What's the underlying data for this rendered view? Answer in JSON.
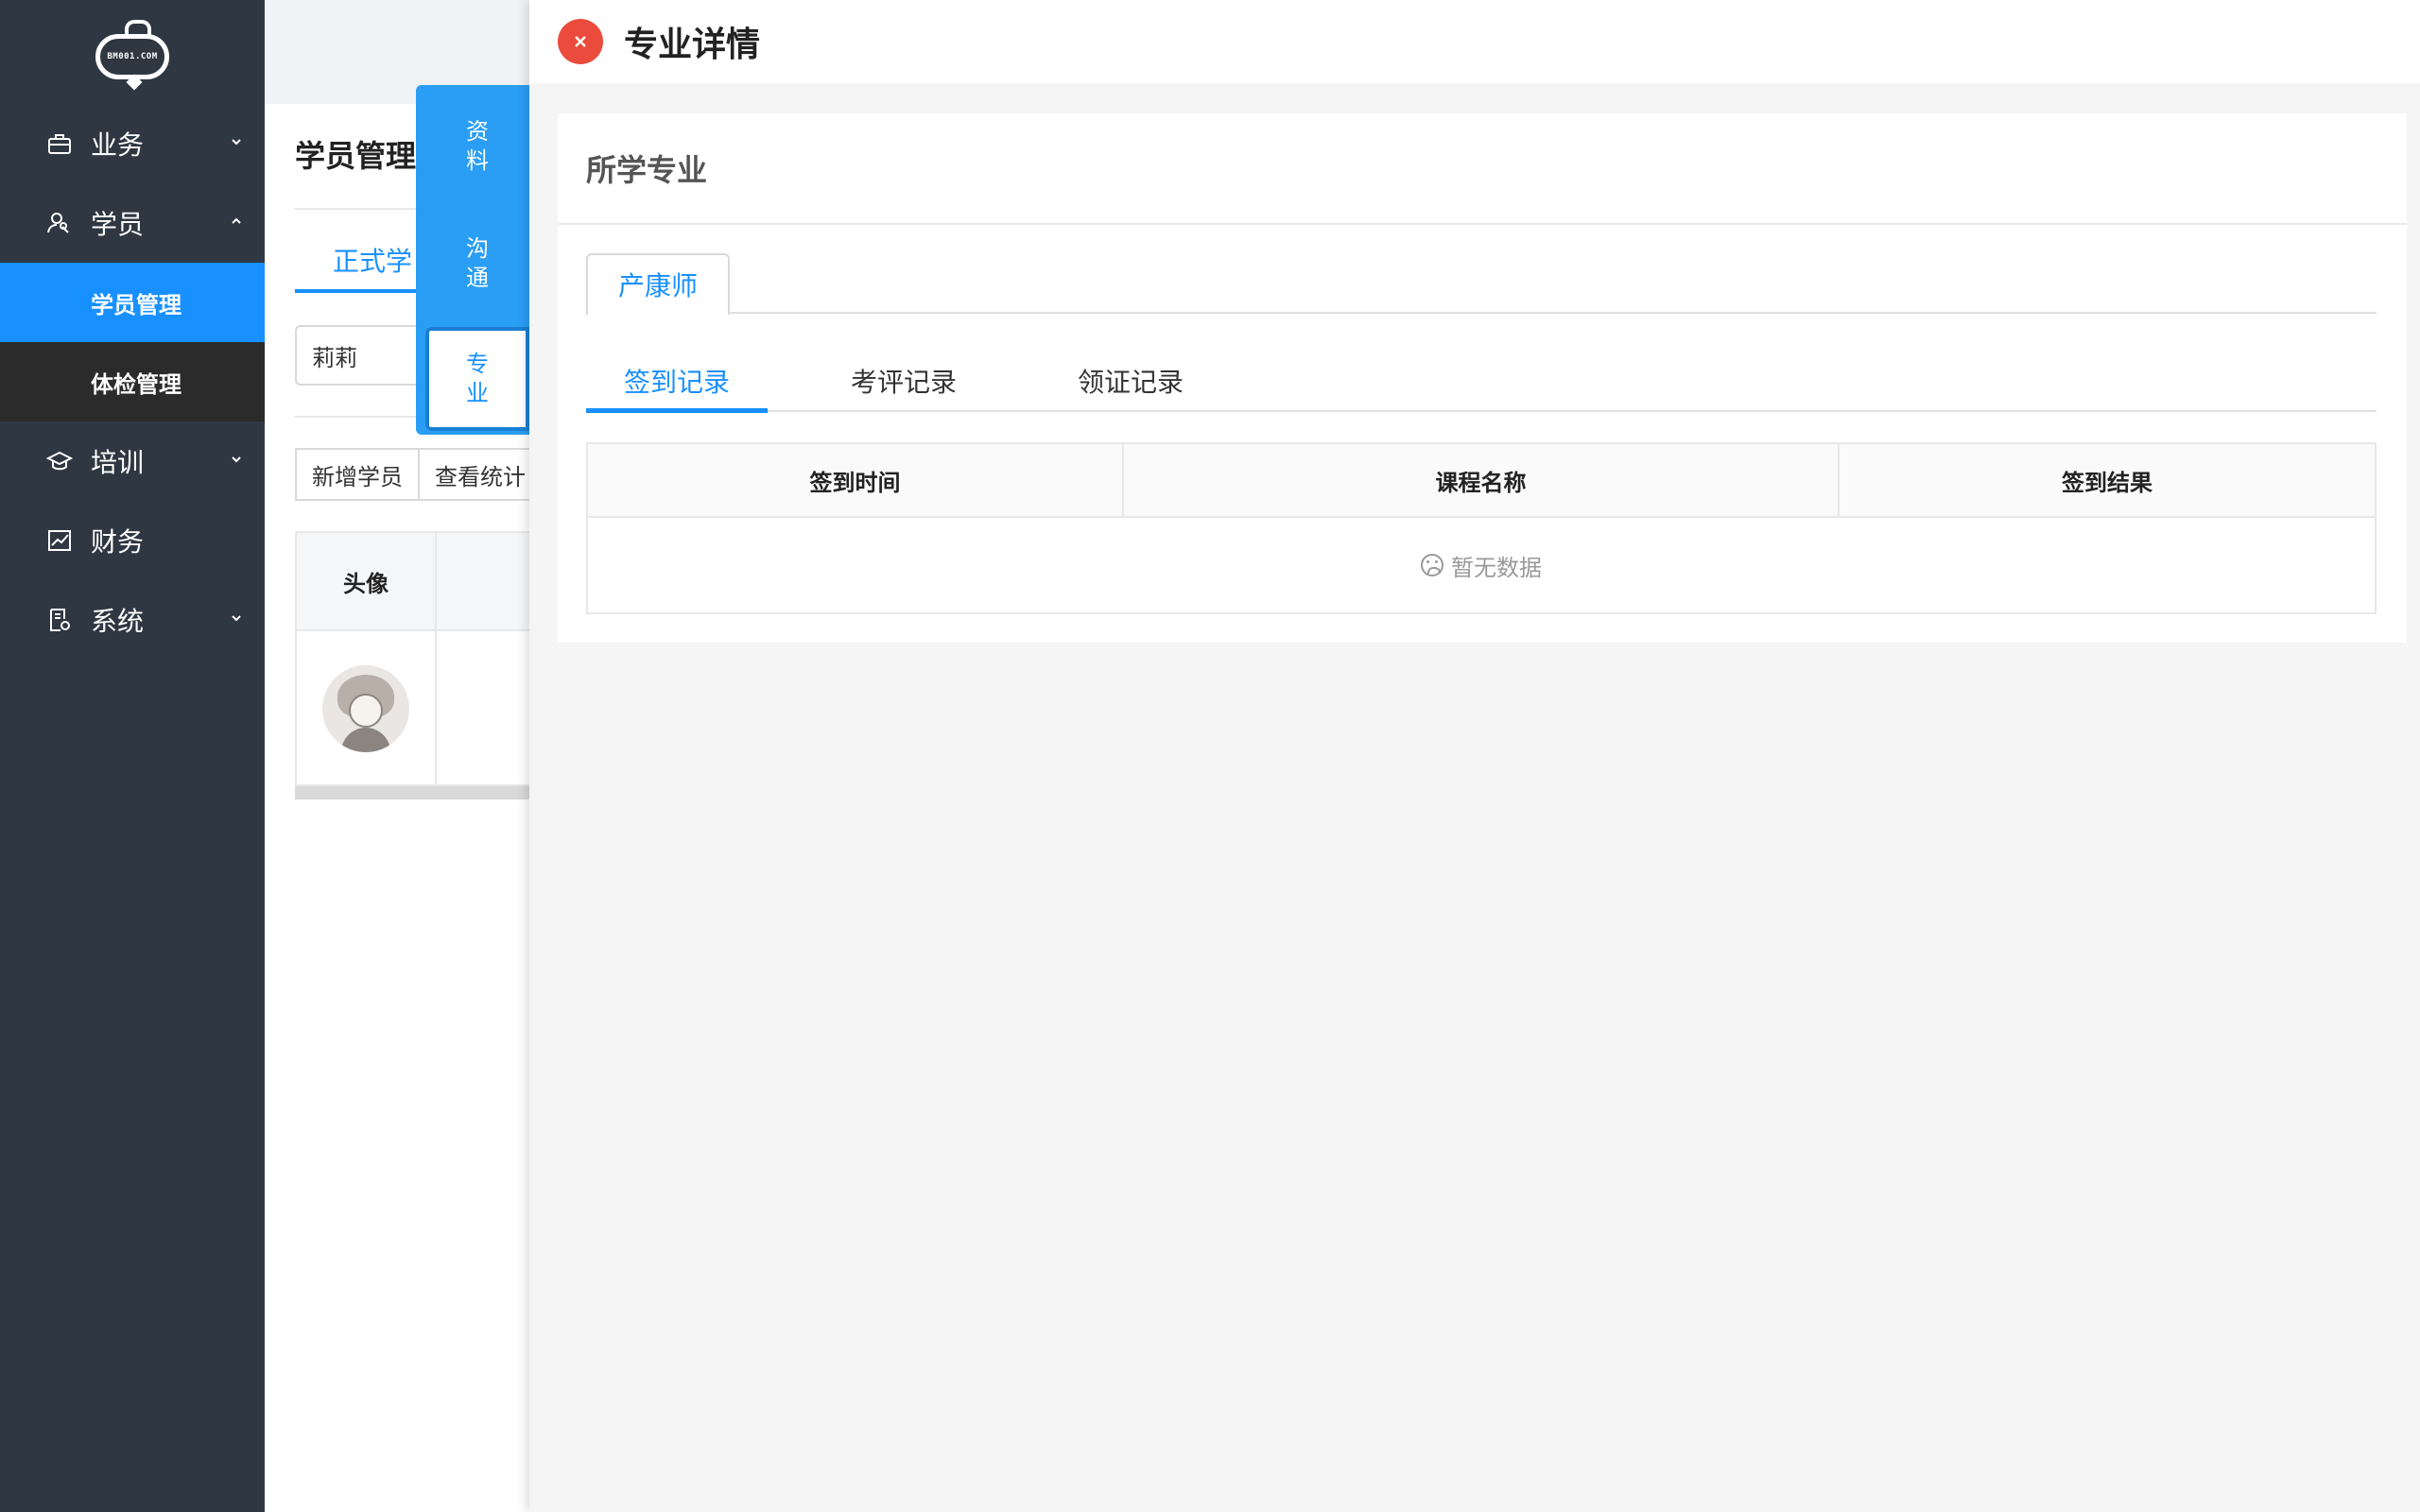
{
  "logo": {
    "text": "BM001.COM"
  },
  "sidebar": {
    "items": [
      {
        "label": "业务",
        "icon": "briefcase-icon",
        "expanded": false
      },
      {
        "label": "学员",
        "icon": "user-search-icon",
        "expanded": true,
        "children": [
          {
            "label": "学员管理",
            "active": true
          },
          {
            "label": "体检管理",
            "active": false
          }
        ]
      },
      {
        "label": "培训",
        "icon": "graduation-cap-icon",
        "expanded": false
      },
      {
        "label": "财务",
        "icon": "chart-icon",
        "expanded": false
      },
      {
        "label": "系统",
        "icon": "settings-doc-icon",
        "expanded": false
      }
    ]
  },
  "main": {
    "title": "学员管理",
    "tab_official": "正式学",
    "search_value": "莉莉",
    "buttons": {
      "add": "新增学员",
      "stats": "查看统计"
    },
    "table": {
      "avatar_header": "头像"
    }
  },
  "side_tabs": {
    "profile": "资\n料",
    "communicate": "沟\n通",
    "major": "专\n业"
  },
  "drawer": {
    "title": "专业详情",
    "card_title": "所学专业",
    "major_tab": "产康师",
    "sub_tabs": [
      "签到记录",
      "考评记录",
      "领证记录"
    ],
    "active_sub_tab": 0,
    "table": {
      "columns": [
        "签到时间",
        "课程名称",
        "签到结果"
      ],
      "empty_text": "暂无数据"
    }
  },
  "colors": {
    "accent": "#1890ff",
    "sidebar": "#2f3742",
    "close": "#ea4b3c"
  }
}
